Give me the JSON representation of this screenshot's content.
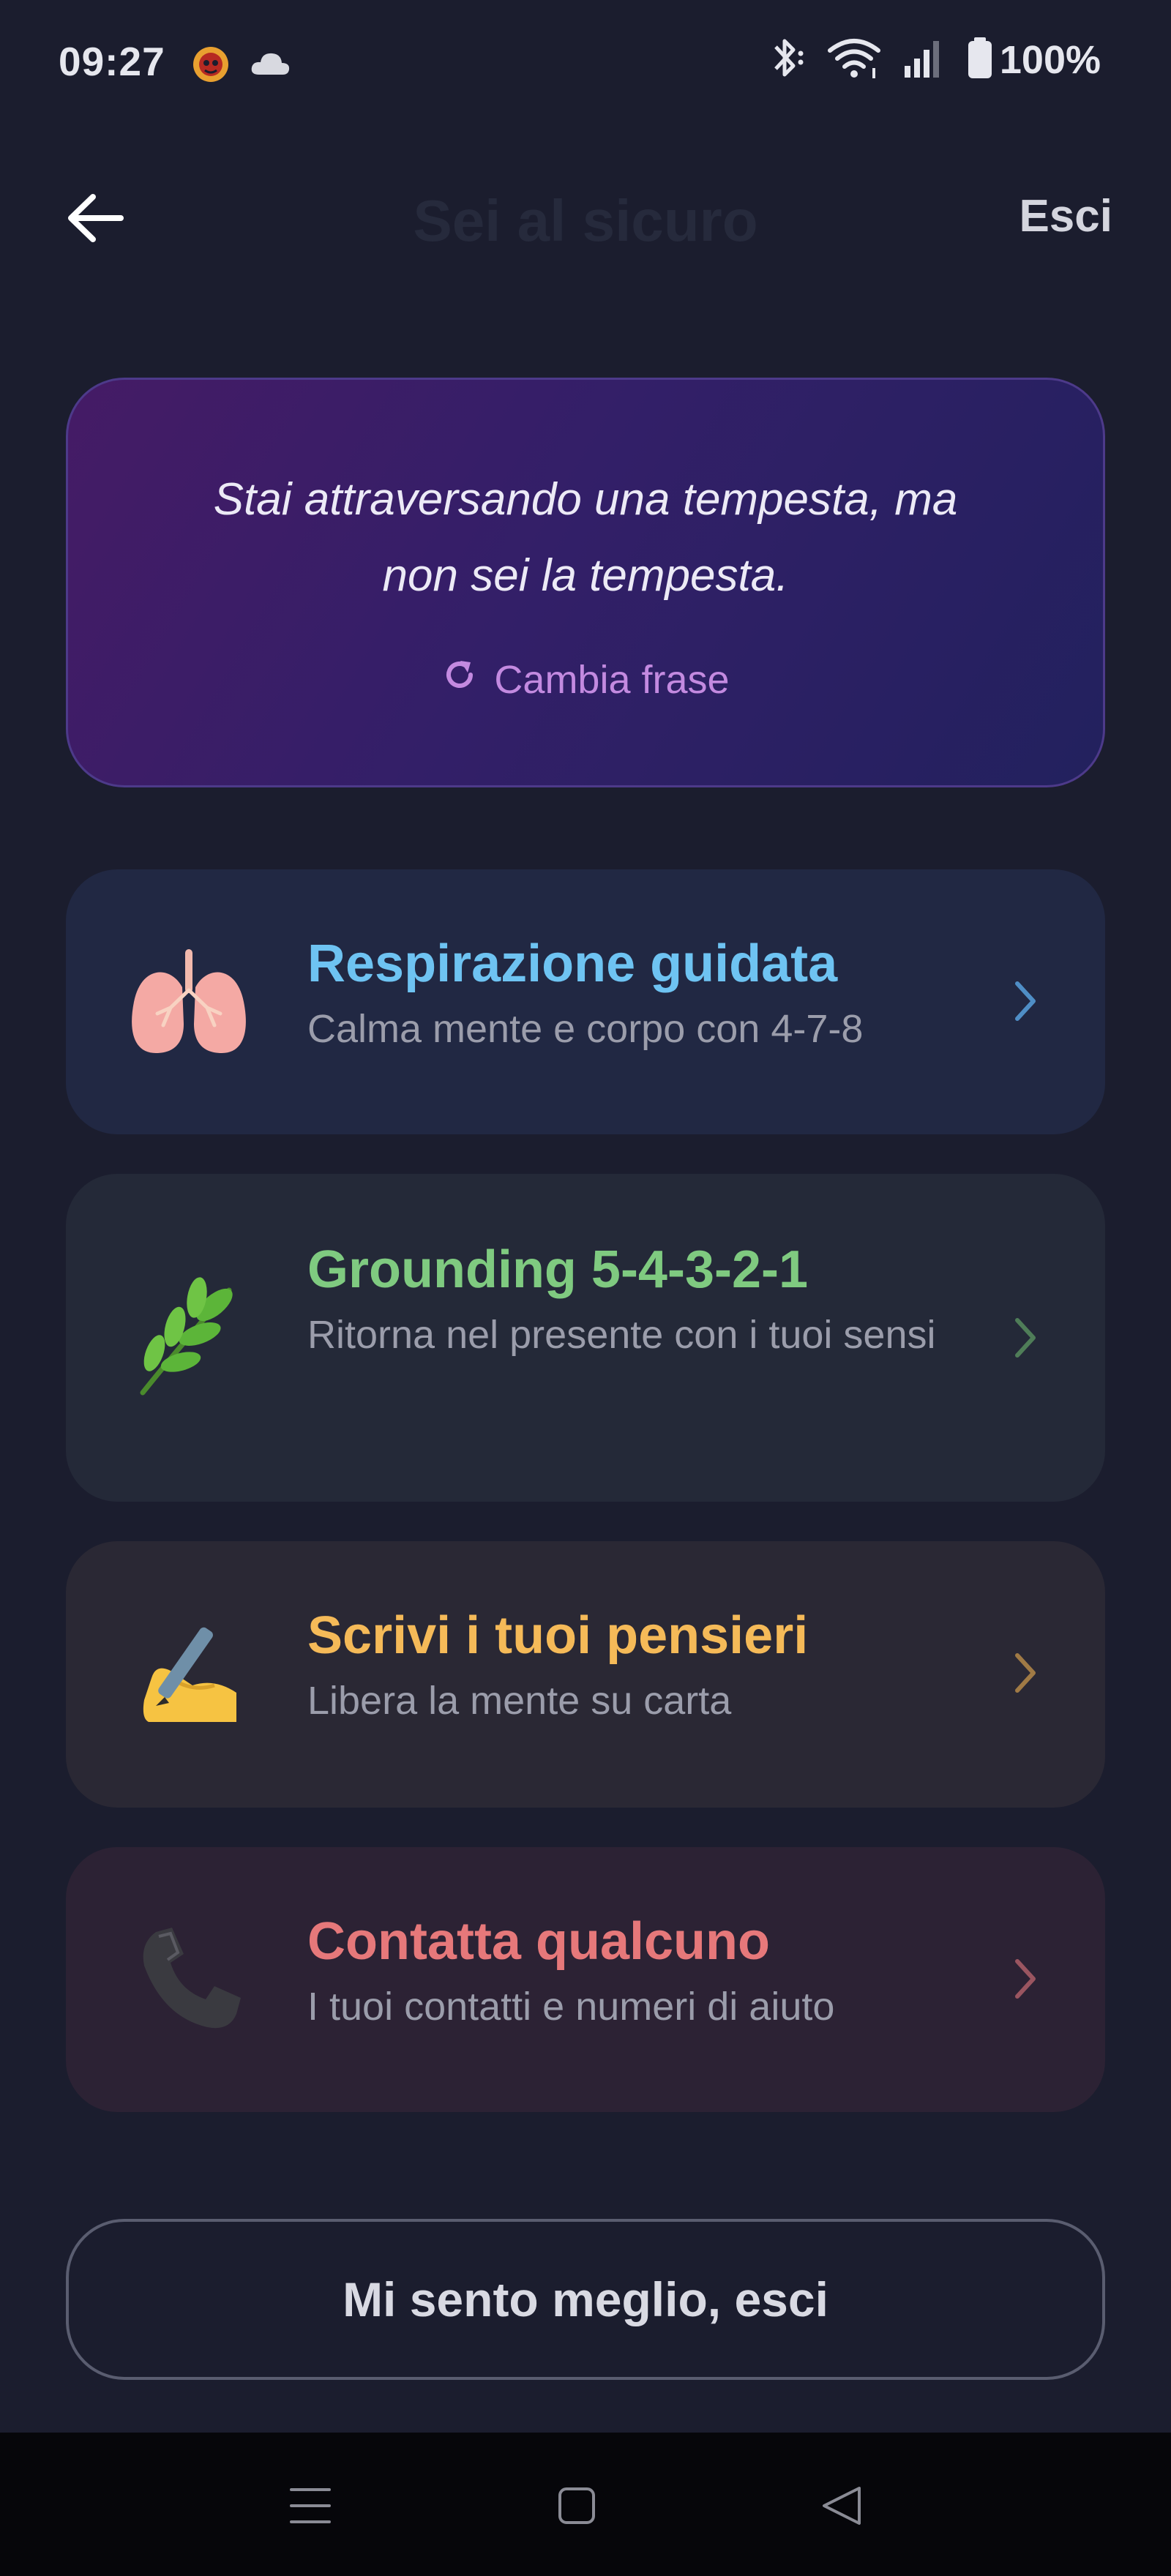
{
  "status_bar": {
    "time": "09:27",
    "battery": "100%",
    "icons": [
      "notification-app-icon",
      "cloud-icon",
      "bluetooth-icon",
      "wifi-icon",
      "signal-icon",
      "battery-icon"
    ]
  },
  "header": {
    "title": "Sei al sicuro",
    "exit_label": "Esci",
    "back_icon": "arrow-left-icon"
  },
  "quote_card": {
    "text": "Stai attraversando una tempesta, ma non sei la tempesta.",
    "change_label": "Cambia frase",
    "change_icon": "refresh-icon"
  },
  "actions": [
    {
      "title": "Respirazione guidata",
      "subtitle": "Calma mente e corpo con 4-7-8",
      "icon": "lungs-icon",
      "accent": "#6ec3f2"
    },
    {
      "title": "Grounding 5-4-3-2-1",
      "subtitle": "Ritorna nel presente con i tuoi sensi",
      "icon": "herb-icon",
      "accent": "#7fca80"
    },
    {
      "title": "Scrivi i tuoi pensieri",
      "subtitle": "Libera la mente su carta",
      "icon": "writing-hand-icon",
      "accent": "#f5ba58"
    },
    {
      "title": "Contatta qualcuno",
      "subtitle": "I tuoi contatti e numeri di aiuto",
      "icon": "telephone-icon",
      "accent": "#e6787a"
    }
  ],
  "footer": {
    "exit_button": "Mi sento meglio, esci"
  },
  "nav_bar": {
    "icons": [
      "menu-icon",
      "home-icon",
      "back-icon"
    ]
  },
  "colors": {
    "background": "#1b1d2e",
    "quote_gradient_start": "#451b66",
    "quote_gradient_end": "#22215e",
    "change_phrase": "#c38ae0"
  }
}
